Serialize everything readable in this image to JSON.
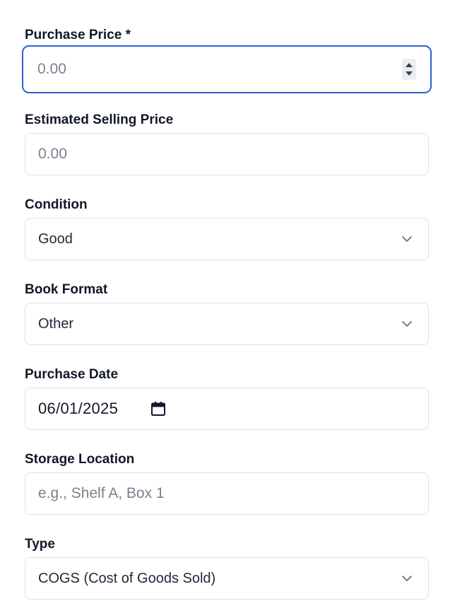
{
  "fields": {
    "purchase_price": {
      "label": "Purchase Price *",
      "placeholder": "0.00"
    },
    "estimated_selling_price": {
      "label": "Estimated Selling Price",
      "placeholder": "0.00"
    },
    "condition": {
      "label": "Condition",
      "value": "Good"
    },
    "book_format": {
      "label": "Book Format",
      "value": "Other"
    },
    "purchase_date": {
      "label": "Purchase Date",
      "value": "06/01/2025"
    },
    "storage_location": {
      "label": "Storage Location",
      "placeholder": "e.g., Shelf A, Box 1"
    },
    "type": {
      "label": "Type",
      "value": "COGS (Cost of Goods Sold)"
    }
  },
  "colors": {
    "focus_border": "#2f5fd6",
    "input_border": "#dfe2e7",
    "placeholder_text": "#7a818c"
  },
  "icons": {
    "spinner": "number-spinner-icon",
    "dropdown": "chevron-down-icon",
    "calendar": "calendar-icon"
  }
}
